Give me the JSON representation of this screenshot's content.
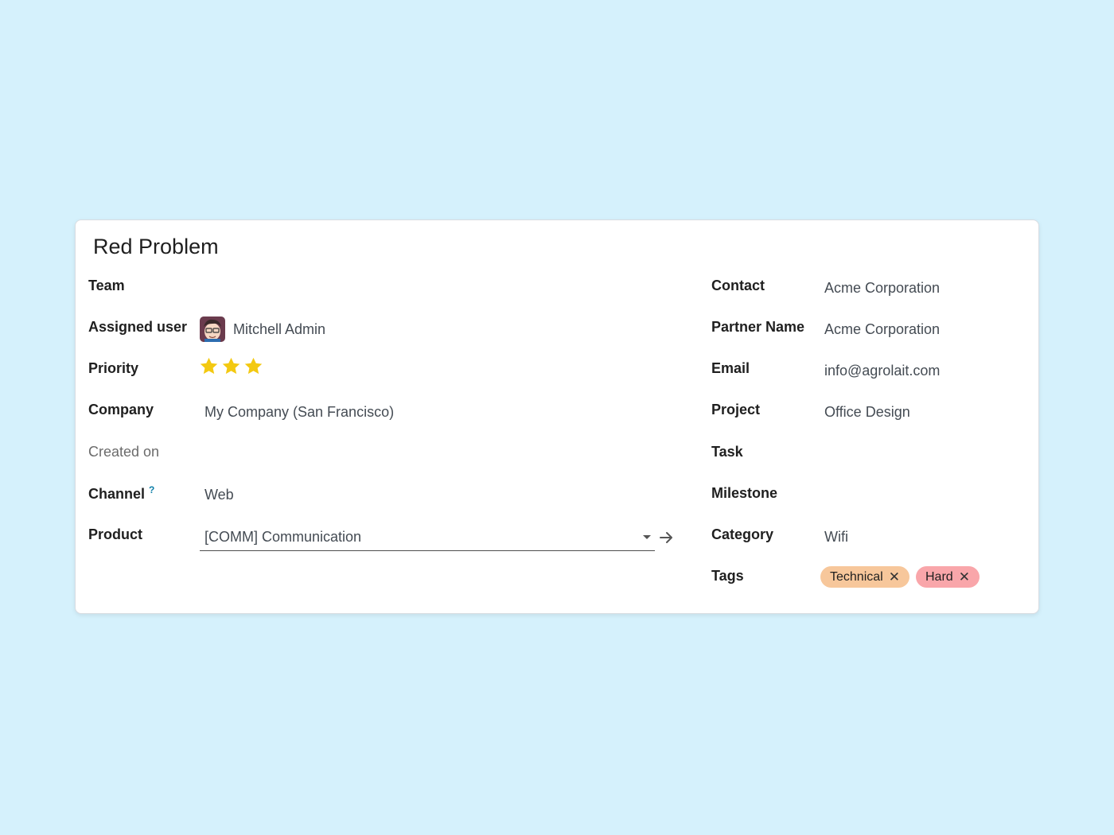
{
  "record": {
    "title": "Red Problem"
  },
  "left_fields": {
    "team": {
      "label": "Team"
    },
    "assigned_user": {
      "label": "Assigned user",
      "value": "Mitchell Admin"
    },
    "priority": {
      "label": "Priority",
      "stars": 3
    },
    "company": {
      "label": "Company",
      "value": "My Company (San Francisco)"
    },
    "created_on": {
      "label": "Created on"
    },
    "channel": {
      "label": "Channel",
      "help": "?",
      "value": "Web"
    },
    "product": {
      "label": "Product",
      "value": "[COMM] Communication"
    }
  },
  "right_fields": {
    "contact": {
      "label": "Contact",
      "value": "Acme Corporation"
    },
    "partner_name": {
      "label": "Partner Name",
      "value": "Acme Corporation"
    },
    "email": {
      "label": "Email",
      "value": "info@agrolait.com"
    },
    "project": {
      "label": "Project",
      "value": "Office Design"
    },
    "task": {
      "label": "Task"
    },
    "milestone": {
      "label": "Milestone"
    },
    "category": {
      "label": "Category",
      "value": "Wifi"
    },
    "tags": {
      "label": "Tags",
      "items": [
        {
          "label": "Technical",
          "color": "#f7c79b"
        },
        {
          "label": "Hard",
          "color": "#f9a6aa"
        }
      ]
    }
  },
  "icons": {
    "avatar": "user-avatar",
    "star": "star-icon",
    "dropdown": "chevron-down-icon",
    "open": "arrow-right-icon",
    "tag_remove": "close-icon"
  },
  "colors": {
    "background": "#d5f1fc",
    "star": "#f3c911",
    "help": "#0d7ea8"
  }
}
